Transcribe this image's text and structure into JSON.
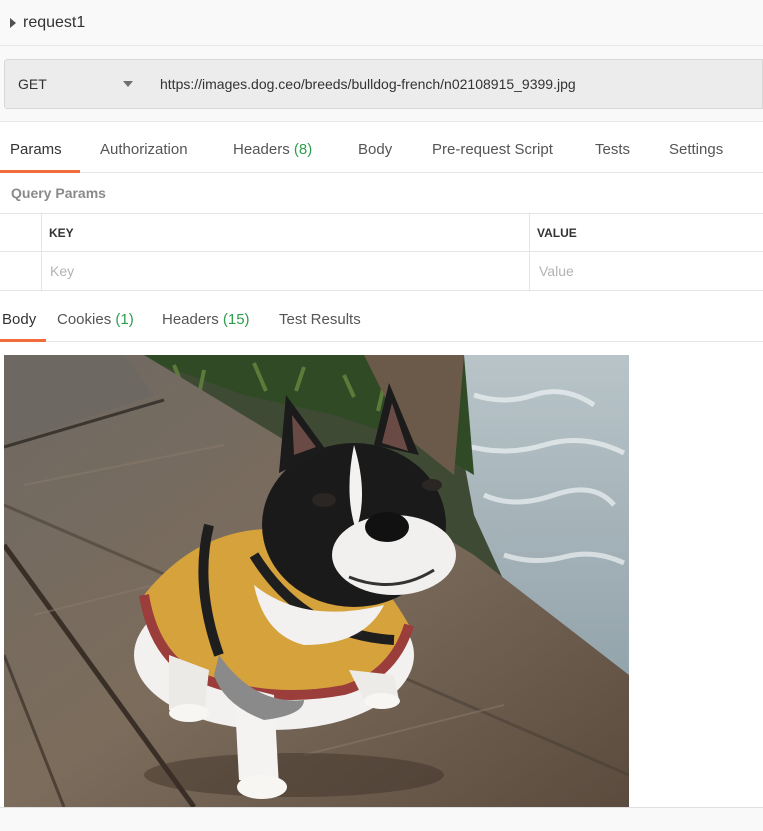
{
  "request": {
    "name": "request1"
  },
  "url_bar": {
    "method": "GET",
    "url": "https://images.dog.ceo/breeds/bulldog-french/n02108915_9399.jpg"
  },
  "request_tabs": [
    {
      "label": "Params",
      "count": ""
    },
    {
      "label": "Authorization",
      "count": ""
    },
    {
      "label": "Headers",
      "count": "(8)"
    },
    {
      "label": "Body",
      "count": ""
    },
    {
      "label": "Pre-request Script",
      "count": ""
    },
    {
      "label": "Tests",
      "count": ""
    },
    {
      "label": "Settings",
      "count": ""
    }
  ],
  "params": {
    "section_title": "Query Params",
    "columns": {
      "key": "KEY",
      "value": "VALUE"
    },
    "placeholders": {
      "key": "Key",
      "value": "Value"
    }
  },
  "response_tabs": [
    {
      "label": "Body",
      "count": ""
    },
    {
      "label": "Cookies",
      "count": "(1)"
    },
    {
      "label": "Headers",
      "count": "(15)"
    },
    {
      "label": "Test Results",
      "count": ""
    }
  ],
  "response_image": {
    "subject": "french-bulldog-photo"
  },
  "colors": {
    "accent": "#f26b3a",
    "count_green": "#2d9e4d"
  }
}
